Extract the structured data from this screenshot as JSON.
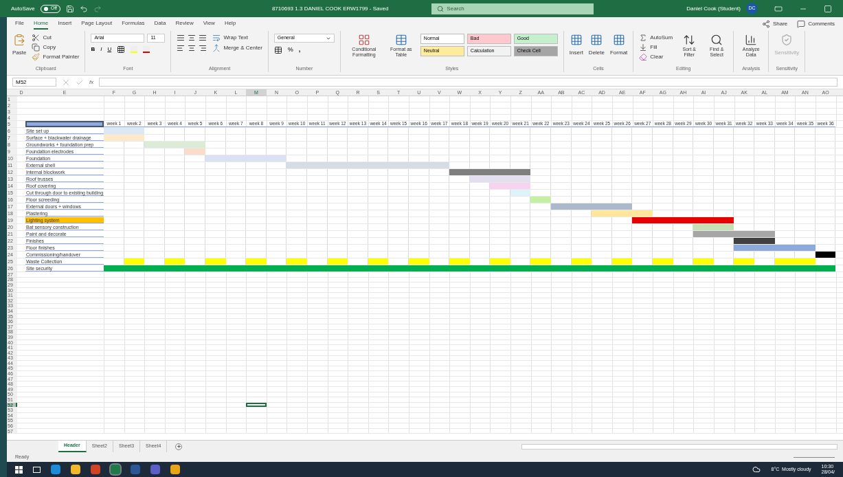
{
  "title_bar": {
    "autosave_label": "AutoSave",
    "autosave_state": "Off",
    "autosave_on": false,
    "title": "8710693 1.3 DANIEL COOK ERW1799 - Saved",
    "search_placeholder": "Search",
    "user": "Daniel Cook (Student)",
    "initials": "DC"
  },
  "tabs": [
    {
      "label": "File",
      "selected": false
    },
    {
      "label": "Home",
      "selected": true
    },
    {
      "label": "Insert",
      "selected": false
    },
    {
      "label": "Page Layout",
      "selected": false
    },
    {
      "label": "Formulas",
      "selected": false
    },
    {
      "label": "Data",
      "selected": false
    },
    {
      "label": "Review",
      "selected": false
    },
    {
      "label": "View",
      "selected": false
    },
    {
      "label": "Help",
      "selected": false
    }
  ],
  "share": "Share",
  "comments": "Comments",
  "ribbon": {
    "clipboard": {
      "paste": "Paste",
      "cut": "Cut",
      "copy": "Copy",
      "format_painter": "Format Painter",
      "label": "Clipboard"
    },
    "font": {
      "name": "Arial",
      "size": "11",
      "bold": "B",
      "italic": "I",
      "underline": "U",
      "label": "Font"
    },
    "alignment": {
      "wrap": "Wrap Text",
      "merge": "Merge & Center",
      "label": "Alignment"
    },
    "number": {
      "format": "General",
      "percent": "%",
      "comma": ",",
      "label": "Number"
    },
    "styles": {
      "conditional": "Conditional Formatting",
      "format_table": "Format as Table",
      "cells": [
        {
          "label": "Normal",
          "color": "#ffffff"
        },
        {
          "label": "Bad",
          "color": "#ffc7ce"
        },
        {
          "label": "Good",
          "color": "#c6efce"
        },
        {
          "label": "Neutral",
          "color": "#ffeb9c"
        },
        {
          "label": "Calculation",
          "color": "#f2f2f2"
        },
        {
          "label": "Check Cell",
          "color": "#a5a5a5"
        }
      ],
      "label": "Styles"
    },
    "cells": {
      "buttons": [
        "Insert",
        "Delete",
        "Format"
      ],
      "label": "Cells"
    },
    "editing": {
      "autosum": "AutoSum",
      "fill": "Fill",
      "clear": "Clear",
      "sort": "Sort & Filter",
      "find": "Find & Select",
      "label": "Editing"
    },
    "analysis": {
      "button": "Analyze Data",
      "label": "Analysis"
    },
    "sensitivity": {
      "button": "Sensitivity",
      "disabled": true,
      "label": "Sensitivity"
    }
  },
  "name_box": "M52",
  "function_label": "fx",
  "columns": [
    {
      "label": "D",
      "selected": false
    },
    {
      "label": "E",
      "selected": false
    },
    {
      "label": "F",
      "selected": false
    },
    {
      "label": "G",
      "selected": false
    },
    {
      "label": "H",
      "selected": false
    },
    {
      "label": "I",
      "selected": false
    },
    {
      "label": "J",
      "selected": false
    },
    {
      "label": "K",
      "selected": false
    },
    {
      "label": "L",
      "selected": false
    },
    {
      "label": "M",
      "selected": true
    },
    {
      "label": "N",
      "selected": false
    },
    {
      "label": "O",
      "selected": false
    },
    {
      "label": "P",
      "selected": false
    },
    {
      "label": "Q",
      "selected": false
    },
    {
      "label": "R",
      "selected": false
    },
    {
      "label": "S",
      "selected": false
    },
    {
      "label": "T",
      "selected": false
    },
    {
      "label": "U",
      "selected": false
    },
    {
      "label": "V",
      "selected": false
    },
    {
      "label": "W",
      "selected": false
    },
    {
      "label": "X",
      "selected": false
    },
    {
      "label": "Y",
      "selected": false
    },
    {
      "label": "Z",
      "selected": false
    },
    {
      "label": "AA",
      "selected": false
    },
    {
      "label": "AB",
      "selected": false
    },
    {
      "label": "AC",
      "selected": false
    },
    {
      "label": "AD",
      "selected": false
    },
    {
      "label": "AE",
      "selected": false
    },
    {
      "label": "AF",
      "selected": false
    },
    {
      "label": "AG",
      "selected": false
    },
    {
      "label": "AH",
      "selected": false
    },
    {
      "label": "AI",
      "selected": false
    },
    {
      "label": "AJ",
      "selected": false
    },
    {
      "label": "AK",
      "selected": false
    },
    {
      "label": "AL",
      "selected": false
    },
    {
      "label": "AM",
      "selected": false
    },
    {
      "label": "AN",
      "selected": false
    },
    {
      "label": "AO",
      "selected": false
    }
  ],
  "rows": [
    {
      "label": "1",
      "selected": false
    },
    {
      "label": "2",
      "selected": false
    },
    {
      "label": "3",
      "selected": false
    },
    {
      "label": "4",
      "selected": false
    },
    {
      "label": "5",
      "selected": false
    },
    {
      "label": "6",
      "selected": false
    },
    {
      "label": "7",
      "selected": false
    },
    {
      "label": "8",
      "selected": false
    },
    {
      "label": "9",
      "selected": false
    },
    {
      "label": "10",
      "selected": false
    },
    {
      "label": "11",
      "selected": false
    },
    {
      "label": "12",
      "selected": false
    },
    {
      "label": "13",
      "selected": false
    },
    {
      "label": "14",
      "selected": false
    },
    {
      "label": "15",
      "selected": false
    },
    {
      "label": "16",
      "selected": false
    },
    {
      "label": "17",
      "selected": false
    },
    {
      "label": "18",
      "selected": false
    },
    {
      "label": "19",
      "selected": false
    },
    {
      "label": "20",
      "selected": false
    },
    {
      "label": "21",
      "selected": false
    },
    {
      "label": "22",
      "selected": false
    },
    {
      "label": "23",
      "selected": false
    },
    {
      "label": "24",
      "selected": false
    },
    {
      "label": "25",
      "selected": false
    },
    {
      "label": "26",
      "selected": false
    },
    {
      "label": "27",
      "selected": false
    },
    {
      "label": "28",
      "selected": false
    },
    {
      "label": "29",
      "selected": false
    },
    {
      "label": "30",
      "selected": false
    },
    {
      "label": "31",
      "selected": false
    },
    {
      "label": "32",
      "selected": false
    },
    {
      "label": "33",
      "selected": false
    },
    {
      "label": "34",
      "selected": false
    },
    {
      "label": "35",
      "selected": false
    },
    {
      "label": "36",
      "selected": false
    },
    {
      "label": "37",
      "selected": false
    },
    {
      "label": "38",
      "selected": false
    },
    {
      "label": "39",
      "selected": false
    },
    {
      "label": "40",
      "selected": false
    },
    {
      "label": "41",
      "selected": false
    },
    {
      "label": "42",
      "selected": false
    },
    {
      "label": "43",
      "selected": false
    },
    {
      "label": "44",
      "selected": false
    },
    {
      "label": "45",
      "selected": false
    },
    {
      "label": "46",
      "selected": false
    },
    {
      "label": "47",
      "selected": false
    },
    {
      "label": "48",
      "selected": false
    },
    {
      "label": "49",
      "selected": false
    },
    {
      "label": "50",
      "selected": false
    },
    {
      "label": "51",
      "selected": false
    },
    {
      "label": "52",
      "selected": true
    },
    {
      "label": "53",
      "selected": false
    },
    {
      "label": "54",
      "selected": false
    },
    {
      "label": "55",
      "selected": false
    },
    {
      "label": "56",
      "selected": false
    },
    {
      "label": "57",
      "selected": false
    }
  ],
  "weeks": [
    "week 1",
    "week 2",
    "week 3",
    "week 4",
    "week 5",
    "week 6",
    "week 7",
    "week 8",
    "week 9",
    "week 10",
    "week 11",
    "week 12",
    "week 13",
    "week 14",
    "week 15",
    "week 16",
    "week 17",
    "week 18",
    "week 19",
    "week 20",
    "week 21",
    "week 22",
    "week 23",
    "week 24",
    "week 25",
    "week 26",
    "week 27",
    "week 28",
    "week 29",
    "week 30",
    "week 31",
    "week 32",
    "week 33",
    "week 34",
    "week 35",
    "week 36"
  ],
  "tasks": [
    {
      "name": "Site set up",
      "highlighted": false,
      "color": "#dce9f5",
      "filled": [
        true,
        true,
        false,
        false,
        false,
        false,
        false,
        false,
        false,
        false,
        false,
        false,
        false,
        false,
        false,
        false,
        false,
        false,
        false,
        false,
        false,
        false,
        false,
        false,
        false,
        false,
        false,
        false,
        false,
        false,
        false,
        false,
        false,
        false,
        false,
        false
      ]
    },
    {
      "name": "Surface + blackwater drainage",
      "highlighted": false,
      "color": "#fde9c8",
      "filled": [
        true,
        true,
        false,
        false,
        false,
        false,
        false,
        false,
        false,
        false,
        false,
        false,
        false,
        false,
        false,
        false,
        false,
        false,
        false,
        false,
        false,
        false,
        false,
        false,
        false,
        false,
        false,
        false,
        false,
        false,
        false,
        false,
        false,
        false,
        false,
        false
      ]
    },
    {
      "name": "Groundworks + foundation prep",
      "highlighted": false,
      "color": "#dcebd5",
      "filled": [
        false,
        false,
        true,
        true,
        true,
        false,
        false,
        false,
        false,
        false,
        false,
        false,
        false,
        false,
        false,
        false,
        false,
        false,
        false,
        false,
        false,
        false,
        false,
        false,
        false,
        false,
        false,
        false,
        false,
        false,
        false,
        false,
        false,
        false,
        false,
        false
      ]
    },
    {
      "name": "Foundation electrodes",
      "highlighted": false,
      "color": "#fbdccb",
      "filled": [
        false,
        false,
        false,
        false,
        true,
        false,
        false,
        false,
        false,
        false,
        false,
        false,
        false,
        false,
        false,
        false,
        false,
        false,
        false,
        false,
        false,
        false,
        false,
        false,
        false,
        false,
        false,
        false,
        false,
        false,
        false,
        false,
        false,
        false,
        false,
        false
      ]
    },
    {
      "name": "Foundation",
      "highlighted": false,
      "color": "#d9e1f2",
      "filled": [
        false,
        false,
        false,
        false,
        false,
        true,
        true,
        true,
        true,
        false,
        false,
        false,
        false,
        false,
        false,
        false,
        false,
        false,
        false,
        false,
        false,
        false,
        false,
        false,
        false,
        false,
        false,
        false,
        false,
        false,
        false,
        false,
        false,
        false,
        false,
        false
      ]
    },
    {
      "name": "External shell",
      "highlighted": false,
      "color": "#d6dce4",
      "filled": [
        false,
        false,
        false,
        false,
        false,
        false,
        false,
        false,
        false,
        true,
        true,
        true,
        true,
        true,
        true,
        true,
        true,
        false,
        false,
        false,
        false,
        false,
        false,
        false,
        false,
        false,
        false,
        false,
        false,
        false,
        false,
        false,
        false,
        false,
        false,
        false
      ]
    },
    {
      "name": "Internal blockwork",
      "highlighted": false,
      "color": "#7f7f7f",
      "filled": [
        false,
        false,
        false,
        false,
        false,
        false,
        false,
        false,
        false,
        false,
        false,
        false,
        false,
        false,
        false,
        false,
        false,
        true,
        true,
        true,
        true,
        false,
        false,
        false,
        false,
        false,
        false,
        false,
        false,
        false,
        false,
        false,
        false,
        false,
        false,
        false
      ]
    },
    {
      "name": "Roof trusses",
      "highlighted": false,
      "color": "#e4dff0",
      "filled": [
        false,
        false,
        false,
        false,
        false,
        false,
        false,
        false,
        false,
        false,
        false,
        false,
        false,
        false,
        false,
        false,
        false,
        false,
        true,
        true,
        true,
        false,
        false,
        false,
        false,
        false,
        false,
        false,
        false,
        false,
        false,
        false,
        false,
        false,
        false,
        false
      ]
    },
    {
      "name": "Roof covering",
      "highlighted": false,
      "color": "#f8d3f0",
      "filled": [
        false,
        false,
        false,
        false,
        false,
        false,
        false,
        false,
        false,
        false,
        false,
        false,
        false,
        false,
        false,
        false,
        false,
        false,
        false,
        true,
        true,
        false,
        false,
        false,
        false,
        false,
        false,
        false,
        false,
        false,
        false,
        false,
        false,
        false,
        false,
        false
      ]
    },
    {
      "name": "Cut through door to existing building",
      "highlighted": false,
      "color": "#dcf3f7",
      "filled": [
        false,
        false,
        false,
        false,
        false,
        false,
        false,
        false,
        false,
        false,
        false,
        false,
        false,
        false,
        false,
        false,
        false,
        false,
        false,
        false,
        true,
        false,
        false,
        false,
        false,
        false,
        false,
        false,
        false,
        false,
        false,
        false,
        false,
        false,
        false,
        false
      ]
    },
    {
      "name": "Floor screeding",
      "highlighted": false,
      "color": "#c5f0a4",
      "filled": [
        false,
        false,
        false,
        false,
        false,
        false,
        false,
        false,
        false,
        false,
        false,
        false,
        false,
        false,
        false,
        false,
        false,
        false,
        false,
        false,
        false,
        true,
        false,
        false,
        false,
        false,
        false,
        false,
        false,
        false,
        false,
        false,
        false,
        false,
        false,
        false
      ]
    },
    {
      "name": "External doors + windows",
      "highlighted": false,
      "color": "#acb9ca",
      "filled": [
        false,
        false,
        false,
        false,
        false,
        false,
        false,
        false,
        false,
        false,
        false,
        false,
        false,
        false,
        false,
        false,
        false,
        false,
        false,
        false,
        false,
        false,
        true,
        true,
        true,
        true,
        false,
        false,
        false,
        false,
        false,
        false,
        false,
        false,
        false,
        false
      ]
    },
    {
      "name": "Plastering",
      "highlighted": false,
      "color": "#ffe699",
      "filled": [
        false,
        false,
        false,
        false,
        false,
        false,
        false,
        false,
        false,
        false,
        false,
        false,
        false,
        false,
        false,
        false,
        false,
        false,
        false,
        false,
        false,
        false,
        false,
        false,
        true,
        true,
        true,
        false,
        false,
        false,
        false,
        false,
        false,
        false,
        false,
        false
      ]
    },
    {
      "name": "Lighting system",
      "highlighted": true,
      "color": "#e60000",
      "filled": [
        false,
        false,
        false,
        false,
        false,
        false,
        false,
        false,
        false,
        false,
        false,
        false,
        false,
        false,
        false,
        false,
        false,
        false,
        false,
        false,
        false,
        false,
        false,
        false,
        false,
        false,
        true,
        true,
        true,
        true,
        true,
        false,
        false,
        false,
        false,
        false
      ]
    },
    {
      "name": "Bat sensory construction",
      "highlighted": false,
      "color": "#c6e0b4",
      "filled": [
        false,
        false,
        false,
        false,
        false,
        false,
        false,
        false,
        false,
        false,
        false,
        false,
        false,
        false,
        false,
        false,
        false,
        false,
        false,
        false,
        false,
        false,
        false,
        false,
        false,
        false,
        false,
        false,
        false,
        true,
        true,
        false,
        false,
        false,
        false,
        false
      ]
    },
    {
      "name": "Paint and decorate",
      "highlighted": false,
      "color": "#a6a6a6",
      "filled": [
        false,
        false,
        false,
        false,
        false,
        false,
        false,
        false,
        false,
        false,
        false,
        false,
        false,
        false,
        false,
        false,
        false,
        false,
        false,
        false,
        false,
        false,
        false,
        false,
        false,
        false,
        false,
        false,
        false,
        true,
        true,
        true,
        true,
        false,
        false,
        false
      ]
    },
    {
      "name": "Finishes",
      "highlighted": false,
      "color": "#404040",
      "filled": [
        false,
        false,
        false,
        false,
        false,
        false,
        false,
        false,
        false,
        false,
        false,
        false,
        false,
        false,
        false,
        false,
        false,
        false,
        false,
        false,
        false,
        false,
        false,
        false,
        false,
        false,
        false,
        false,
        false,
        false,
        false,
        true,
        true,
        false,
        false,
        false
      ]
    },
    {
      "name": "Floor finishes",
      "highlighted": false,
      "color": "#8eaadb",
      "filled": [
        false,
        false,
        false,
        false,
        false,
        false,
        false,
        false,
        false,
        false,
        false,
        false,
        false,
        false,
        false,
        false,
        false,
        false,
        false,
        false,
        false,
        false,
        false,
        false,
        false,
        false,
        false,
        false,
        false,
        false,
        false,
        true,
        true,
        true,
        true,
        false
      ]
    },
    {
      "name": "Commissioning/handover",
      "highlighted": false,
      "color": "#000000",
      "filled": [
        false,
        false,
        false,
        false,
        false,
        false,
        false,
        false,
        false,
        false,
        false,
        false,
        false,
        false,
        false,
        false,
        false,
        false,
        false,
        false,
        false,
        false,
        false,
        false,
        false,
        false,
        false,
        false,
        false,
        false,
        false,
        false,
        false,
        false,
        false,
        true
      ]
    },
    {
      "name": "Waste Collection",
      "highlighted": false,
      "color": "#ffff00",
      "filled": [
        false,
        true,
        false,
        true,
        false,
        true,
        false,
        true,
        false,
        true,
        false,
        true,
        false,
        true,
        false,
        true,
        false,
        true,
        false,
        true,
        false,
        true,
        false,
        true,
        false,
        true,
        false,
        true,
        false,
        true,
        false,
        true,
        false,
        true,
        true,
        false
      ]
    },
    {
      "name": "Site security",
      "highlighted": false,
      "color": "#00b050",
      "filled": [
        true,
        true,
        true,
        true,
        true,
        true,
        true,
        true,
        true,
        true,
        true,
        true,
        true,
        true,
        true,
        true,
        true,
        true,
        true,
        true,
        true,
        true,
        true,
        true,
        true,
        true,
        true,
        true,
        true,
        true,
        true,
        true,
        true,
        true,
        true,
        true
      ]
    }
  ],
  "sheets": [
    {
      "label": "Header",
      "selected": true
    },
    {
      "label": "Sheet2",
      "selected": false
    },
    {
      "label": "Sheet3",
      "selected": false
    },
    {
      "label": "Sheet4",
      "selected": false
    }
  ],
  "status": "Ready",
  "taskbar": {
    "apps": [
      {
        "kind": "edge",
        "active": false
      },
      {
        "kind": "explorer",
        "active": false
      },
      {
        "kind": "powerpoint",
        "active": false
      },
      {
        "kind": "excel",
        "active": true
      },
      {
        "kind": "word",
        "active": false
      },
      {
        "kind": "teams",
        "active": false
      },
      {
        "kind": "chrome",
        "active": false
      }
    ],
    "weather": "8°C  Mostly cloudy",
    "time": "10:30",
    "date": "28/04/"
  }
}
